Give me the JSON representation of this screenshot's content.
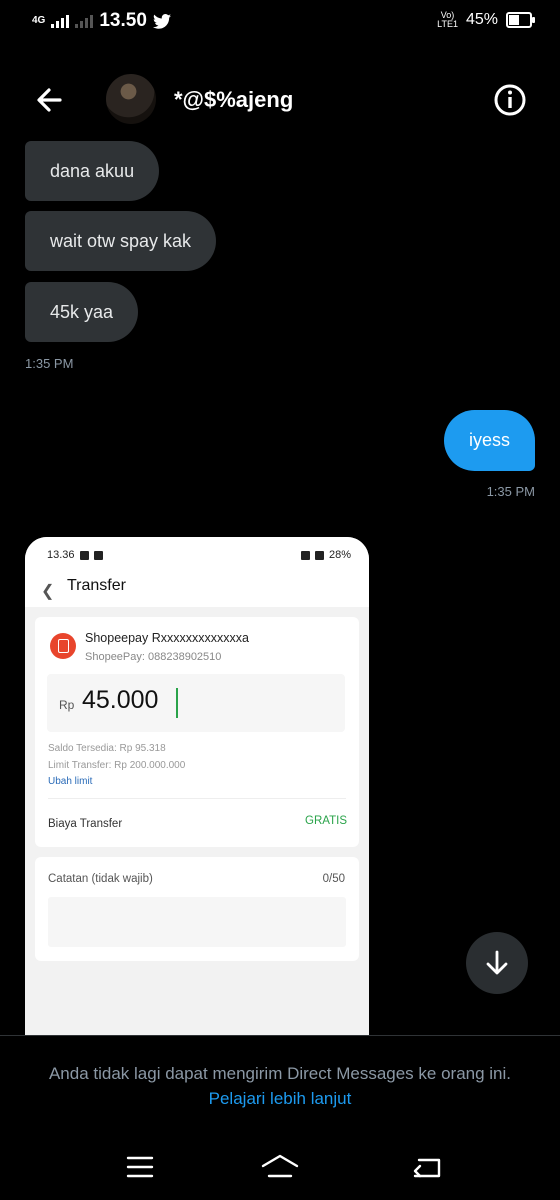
{
  "status_bar": {
    "network": "4G",
    "time": "13.50",
    "volte_line1": "Vo)",
    "volte_line2": "LTE1",
    "battery": "45%",
    "icons": [
      "signal-icon",
      "twitter-icon",
      "volte-icon",
      "battery-icon"
    ]
  },
  "header": {
    "name": "*@$%ajeng",
    "icons": [
      "back-arrow-icon",
      "info-icon"
    ]
  },
  "messages": [
    {
      "text": "dana akuu",
      "from": "them"
    },
    {
      "text": "wait otw spay kak",
      "from": "them"
    },
    {
      "text": "45k yaa",
      "from": "them"
    },
    {
      "time": "1:35 PM"
    },
    {
      "text": "iyess",
      "from": "me"
    },
    {
      "time": "1:35 PM"
    }
  ],
  "shared_image": {
    "status_time": "13.36",
    "status_battery": "28%",
    "title": "Transfer",
    "recipient": "Shopeepay Rxxxxxxxxxxxxxa",
    "recipient_sub": "ShopeePay: 088238902510",
    "currency": "Rp",
    "amount": "45.000",
    "saldo": "Saldo Tersedia: Rp 95.318",
    "limit": "Limit Transfer: Rp 200.000.000",
    "ubah_limit": "Ubah limit",
    "fee_label": "Biaya Transfer",
    "fee_value": "GRATIS",
    "note_label": "Catatan (tidak wajib)",
    "note_count": "0/50"
  },
  "footer": {
    "notice": "Anda tidak lagi dapat mengirim Direct Messages ke orang ini.",
    "learn_more": "Pelajari lebih lanjut"
  },
  "colors": {
    "accent": "#1d9bf0",
    "bubble_them": "#2f3336",
    "muted": "#8b98a5",
    "success": "#2aa34a",
    "shopeepay": "#e8452c"
  }
}
